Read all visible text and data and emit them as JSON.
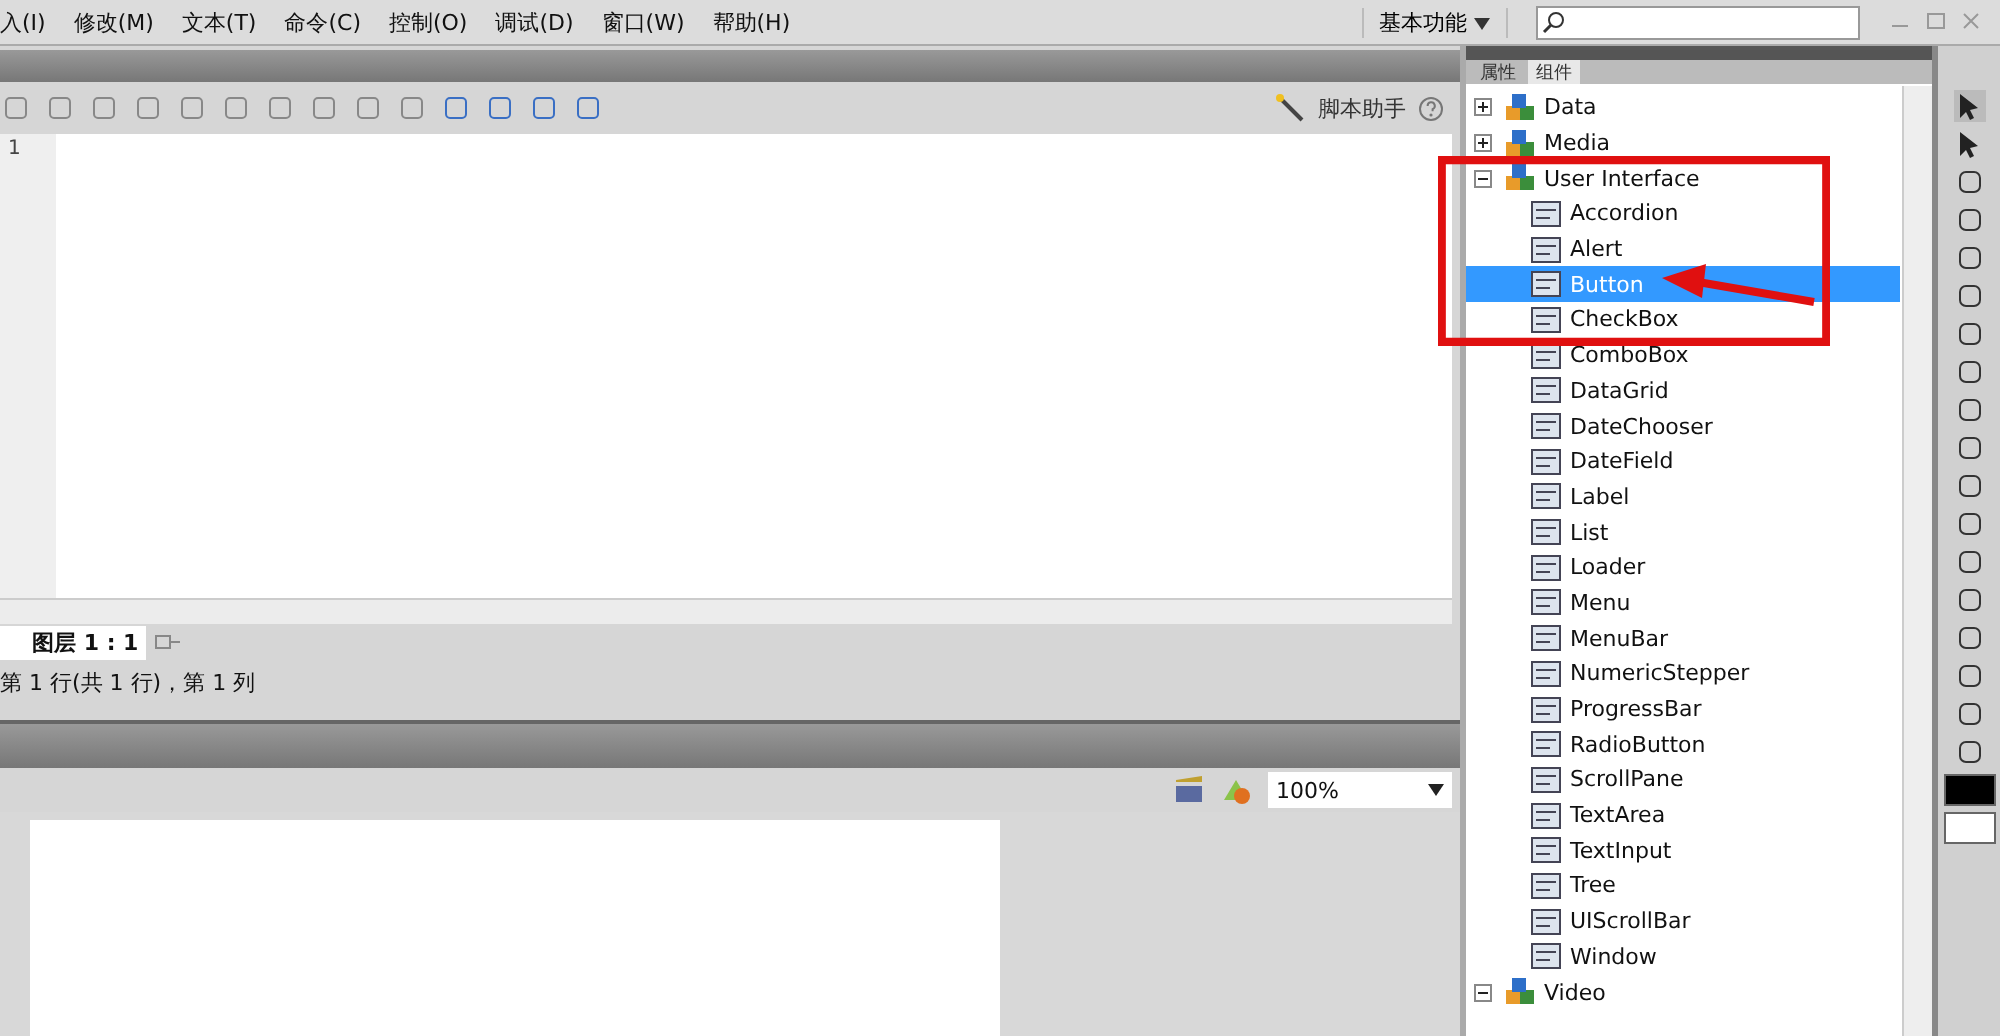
{
  "menu": [
    "入(I)",
    "修改(M)",
    "文本(T)",
    "命令(C)",
    "控制(O)",
    "调试(D)",
    "窗口(W)",
    "帮助(H)"
  ],
  "workspace": {
    "label": "基本功能"
  },
  "script_assistant": {
    "label": "脚本助手"
  },
  "editor": {
    "line_numbers": [
      "1"
    ]
  },
  "layer_tab": {
    "label": "图层 1 : 1"
  },
  "status": "第 1 行(共 1 行)，第 1 列",
  "zoom": {
    "value": "100%"
  },
  "panel_tabs": [
    {
      "label": "属性",
      "selected": false
    },
    {
      "label": "组件",
      "selected": true
    }
  ],
  "tree": [
    {
      "label": "Data",
      "expanded": false
    },
    {
      "label": "Media",
      "expanded": false
    },
    {
      "label": "User Interface",
      "expanded": true,
      "children": [
        {
          "label": "Accordion",
          "selected": false
        },
        {
          "label": "Alert",
          "selected": false
        },
        {
          "label": "Button",
          "selected": true
        },
        {
          "label": "CheckBox",
          "selected": false
        },
        {
          "label": "ComboBox",
          "selected": false
        },
        {
          "label": "DataGrid",
          "selected": false
        },
        {
          "label": "DateChooser",
          "selected": false
        },
        {
          "label": "DateField",
          "selected": false
        },
        {
          "label": "Label",
          "selected": false
        },
        {
          "label": "List",
          "selected": false
        },
        {
          "label": "Loader",
          "selected": false
        },
        {
          "label": "Menu",
          "selected": false
        },
        {
          "label": "MenuBar",
          "selected": false
        },
        {
          "label": "NumericStepper",
          "selected": false
        },
        {
          "label": "ProgressBar",
          "selected": false
        },
        {
          "label": "RadioButton",
          "selected": false
        },
        {
          "label": "ScrollPane",
          "selected": false
        },
        {
          "label": "TextArea",
          "selected": false
        },
        {
          "label": "TextInput",
          "selected": false
        },
        {
          "label": "Tree",
          "selected": false
        },
        {
          "label": "UIScrollBar",
          "selected": false
        },
        {
          "label": "Window",
          "selected": false
        }
      ]
    },
    {
      "label": "Video",
      "expanded": true
    }
  ]
}
